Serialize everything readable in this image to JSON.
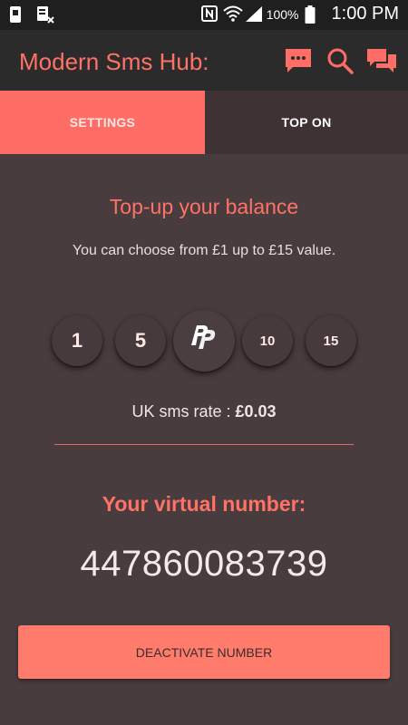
{
  "status_bar": {
    "battery_percent": "100%",
    "time": "1:00 PM",
    "icons": [
      "sim-icon",
      "sim-card-x-icon",
      "nfc-icon",
      "wifi-icon",
      "signal-icon",
      "battery-icon"
    ]
  },
  "app_bar": {
    "title": "Modern Sms Hub:",
    "actions": [
      "chat-bubble-icon",
      "search-icon",
      "messages-icon"
    ]
  },
  "tabs": [
    {
      "label": "SETTINGS",
      "selected": true
    },
    {
      "label": "TOP ON",
      "selected": false
    }
  ],
  "topup": {
    "heading": "Top-up your balance",
    "subtitle": "You can choose from £1 up to £15 value.",
    "amounts": [
      "1",
      "5",
      "10",
      "15"
    ],
    "paypal_icon": "paypal-icon"
  },
  "rate": {
    "label": "UK sms rate : ",
    "value": "£0.03"
  },
  "virtual_number": {
    "heading": "Your virtual number:",
    "number": "447860083739"
  },
  "deactivate_button": "DEACTIVATE NUMBER",
  "colors": {
    "background": "#493c3e",
    "accent": "#ff7266",
    "app_bar": "#2b2b2b",
    "status_bar": "#1f1f1f"
  }
}
